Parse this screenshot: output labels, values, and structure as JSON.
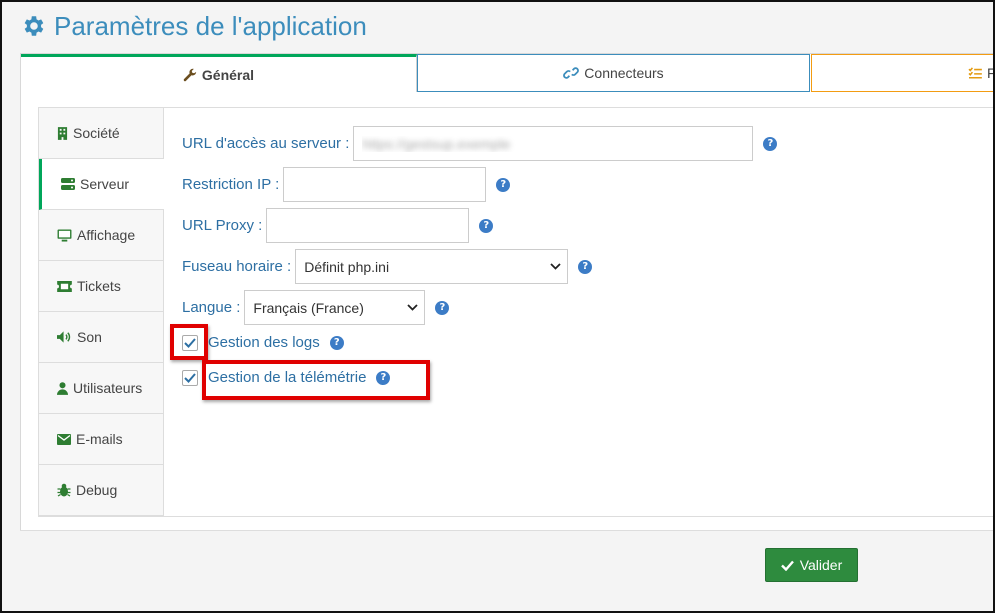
{
  "page": {
    "title": "Paramètres de l'application"
  },
  "tabs": [
    {
      "label": "Général"
    },
    {
      "label": "Connecteurs"
    },
    {
      "label": "F"
    }
  ],
  "sidebar": {
    "items": [
      {
        "label": "Société"
      },
      {
        "label": "Serveur"
      },
      {
        "label": "Affichage"
      },
      {
        "label": "Tickets"
      },
      {
        "label": "Son"
      },
      {
        "label": "Utilisateurs"
      },
      {
        "label": "E-mails"
      },
      {
        "label": "Debug"
      }
    ]
  },
  "form": {
    "url_server": {
      "label": "URL d'accès au serveur :",
      "value": "https://gestsup.exemple"
    },
    "restriction_ip": {
      "label": "Restriction IP :",
      "value": ""
    },
    "url_proxy": {
      "label": "URL Proxy :",
      "value": ""
    },
    "timezone": {
      "label": "Fuseau horaire :",
      "value": "Définit php.ini"
    },
    "language": {
      "label": "Langue :",
      "value": "Français (France)"
    },
    "logs": {
      "label": "Gestion des logs",
      "checked": true
    },
    "telemetry": {
      "label": "Gestion de la télémétrie",
      "checked": true
    },
    "help_glyph": "?"
  },
  "footer": {
    "validate_label": "Valider"
  },
  "colors": {
    "accent": "#3c8dbc",
    "success": "#00a65a",
    "button": "#2e8b3e",
    "highlight": "#e00000"
  }
}
